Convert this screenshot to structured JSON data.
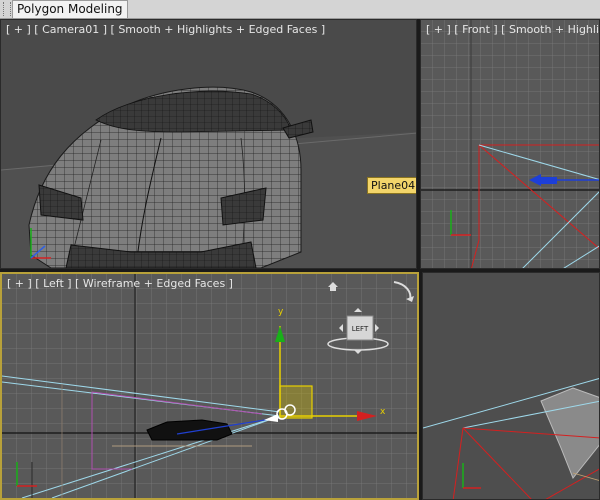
{
  "ribbon": {
    "tab_label": "Polygon Modeling"
  },
  "viewports": {
    "camera": {
      "label": "[ + ] [ Camera01 ] [ Smooth + Highlights + Edged Faces ]",
      "tooltip": "Plane04"
    },
    "front": {
      "label": "[ + ] [ Front ] [ Smooth + Highlights + Edged Faces ]"
    },
    "left": {
      "label": "[ + ] [ Left ] [ Wireframe + Edged Faces ]",
      "viewcube_label": "LEFT",
      "gizmo_x": "x",
      "gizmo_y": "y"
    }
  },
  "colors": {
    "active_border": "#b8a13a",
    "tooltip_bg": "#f3d56a",
    "gizmo_x": "#d42020",
    "gizmo_y": "#19b019",
    "gizmo_plane": "#e8d000",
    "camera_lines": "#9ed8ea"
  }
}
